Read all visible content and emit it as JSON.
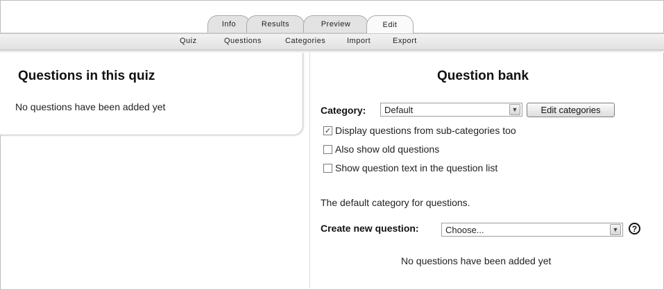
{
  "tabs": {
    "info": "Info",
    "results": "Results",
    "preview": "Preview",
    "edit": "Edit"
  },
  "subtabs": {
    "quiz": "Quiz",
    "questions": "Questions",
    "categories": "Categories",
    "import": "Import",
    "export": "Export"
  },
  "left": {
    "title": "Questions in this quiz",
    "empty_message": "No questions have been added yet"
  },
  "right": {
    "title": "Question bank",
    "category_label": "Category:",
    "category_value": "Default",
    "edit_categories_button": "Edit categories",
    "checkboxes": [
      {
        "label": "Display questions from sub-categories too",
        "checked": true
      },
      {
        "label": "Also show old questions",
        "checked": false
      },
      {
        "label": "Show question text in the question list",
        "checked": false
      }
    ],
    "category_description": "The default category for questions.",
    "create_label": "Create new question:",
    "create_value": "Choose...",
    "help_icon": "?",
    "empty_message": "No questions have been added yet"
  },
  "icons": {
    "dropdown": "chevron-down-icon",
    "help": "help-icon",
    "check": "checkmark-icon"
  }
}
